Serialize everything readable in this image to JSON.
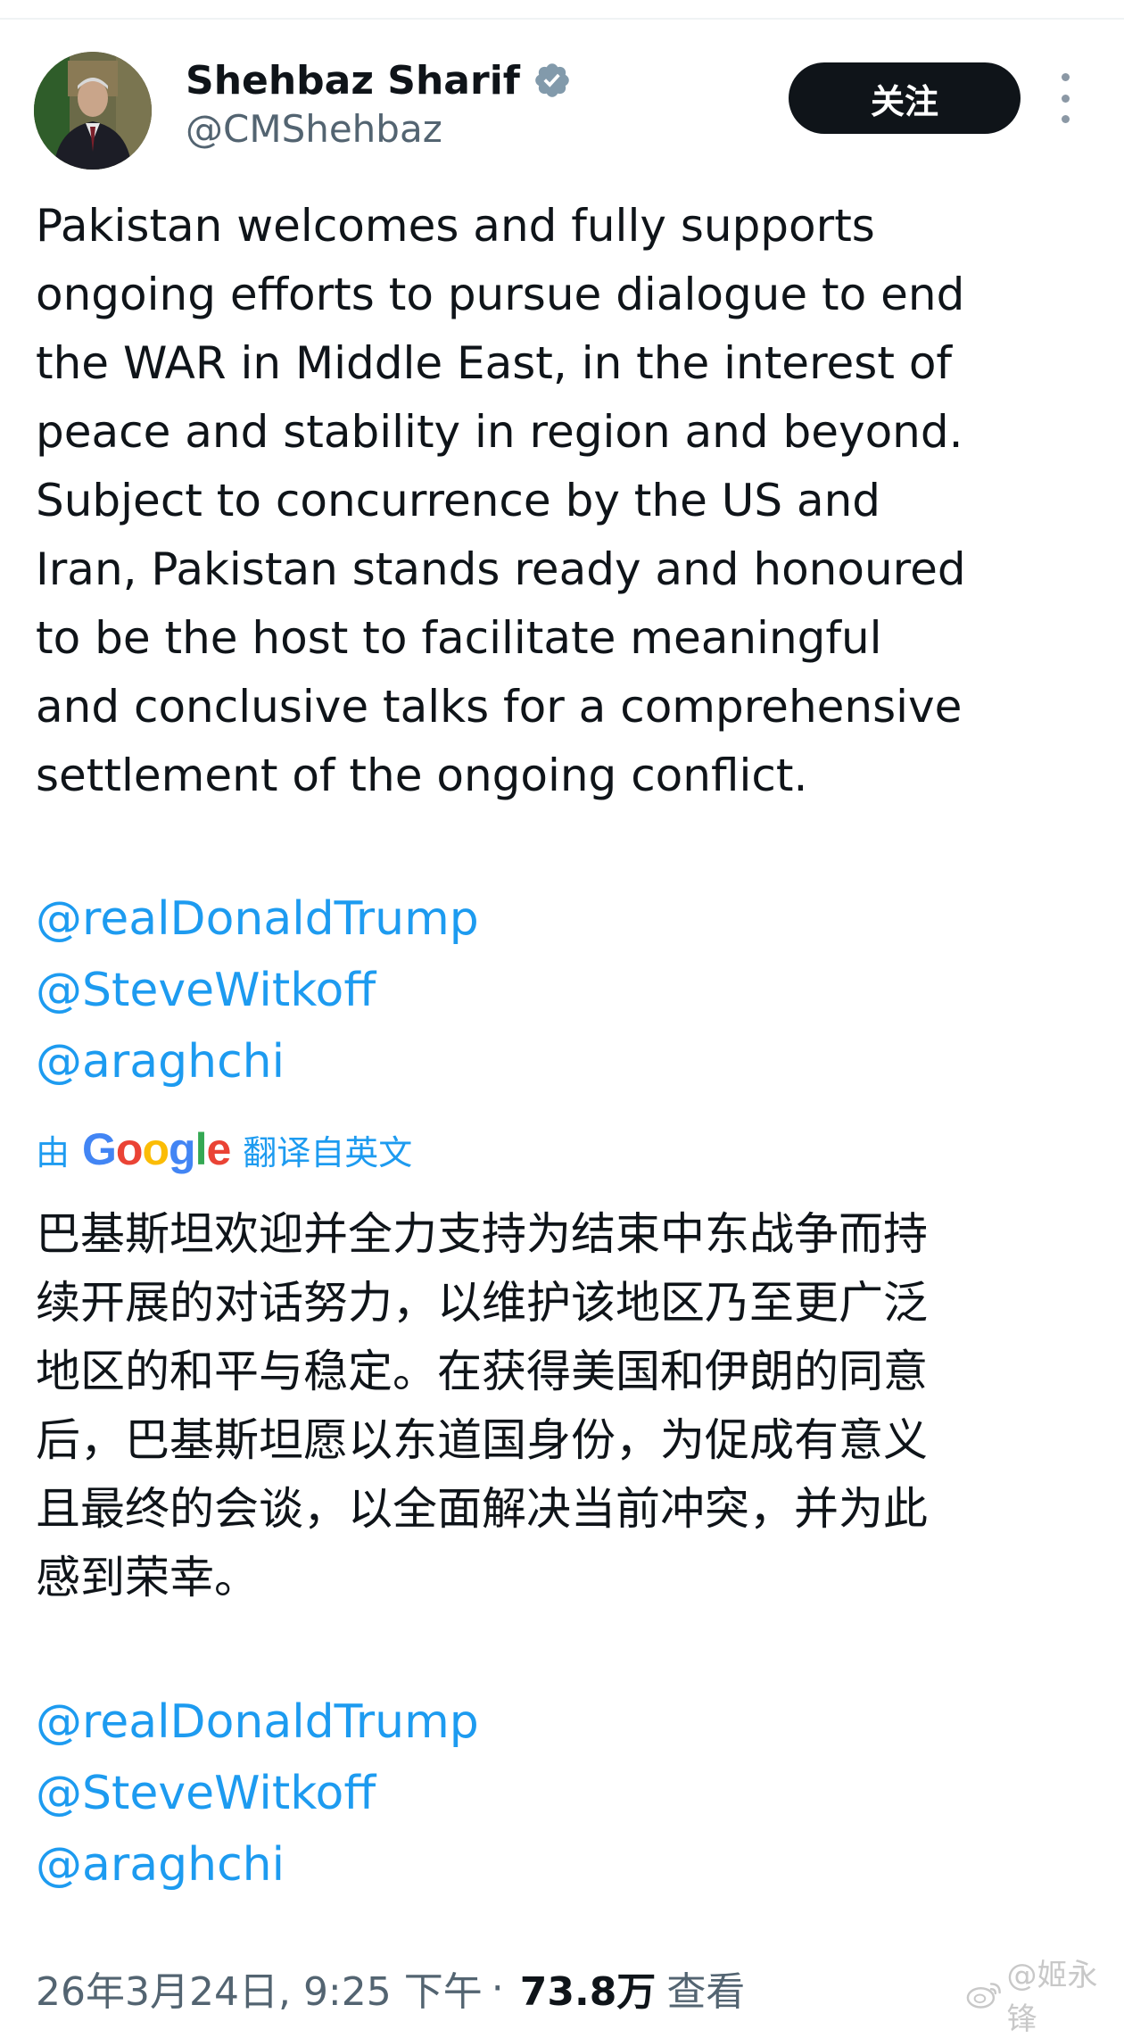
{
  "author": {
    "display_name": "Shehbaz Sharif",
    "handle": "@CMShehbaz",
    "verified": true,
    "verified_color": "#829aab"
  },
  "actions": {
    "follow_label": "关注",
    "more_icon": "more-vertical-icon"
  },
  "tweet": {
    "lines": [
      "Pakistan welcomes and fully supports",
      "ongoing efforts to pursue dialogue to end",
      "the WAR in Middle East, in the interest of",
      "peace and stability in region and beyond.",
      "Subject to concurrence by the US and",
      "Iran, Pakistan stands ready and honoured",
      "to be the host to facilitate meaningful",
      "and conclusive talks for a comprehensive",
      "settlement of the ongoing conflict."
    ],
    "mentions": [
      "@realDonaldTrump",
      "@SteveWitkoff",
      "@araghchi"
    ]
  },
  "translation": {
    "prefix": "由",
    "provider_letters": [
      "G",
      "o",
      "o",
      "g",
      "l",
      "e"
    ],
    "suffix": "翻译自英文",
    "lines": [
      "巴基斯坦欢迎并全力支持为结束中东战争而持",
      "续开展的对话努力，以维护该地区乃至更广泛",
      "地区的和平与稳定。在获得美国和伊朗的同意",
      "后，巴基斯坦愿以东道国身份，为促成有意义",
      "且最终的会谈，以全面解决当前冲突，并为此",
      "感到荣幸。"
    ],
    "mentions": [
      "@realDonaldTrump",
      "@SteveWitkoff",
      "@araghchi"
    ]
  },
  "meta": {
    "timestamp": "26年3月24日, 9:25 下午",
    "separator": "·",
    "views_count": "73.8万",
    "views_label": "查看"
  },
  "watermark": {
    "text": "@姬永锋",
    "icon": "weibo-icon"
  },
  "colors": {
    "link": "#1d9bf0",
    "text": "#0f1419",
    "secondary": "#536471",
    "button_bg": "#0f1419"
  }
}
